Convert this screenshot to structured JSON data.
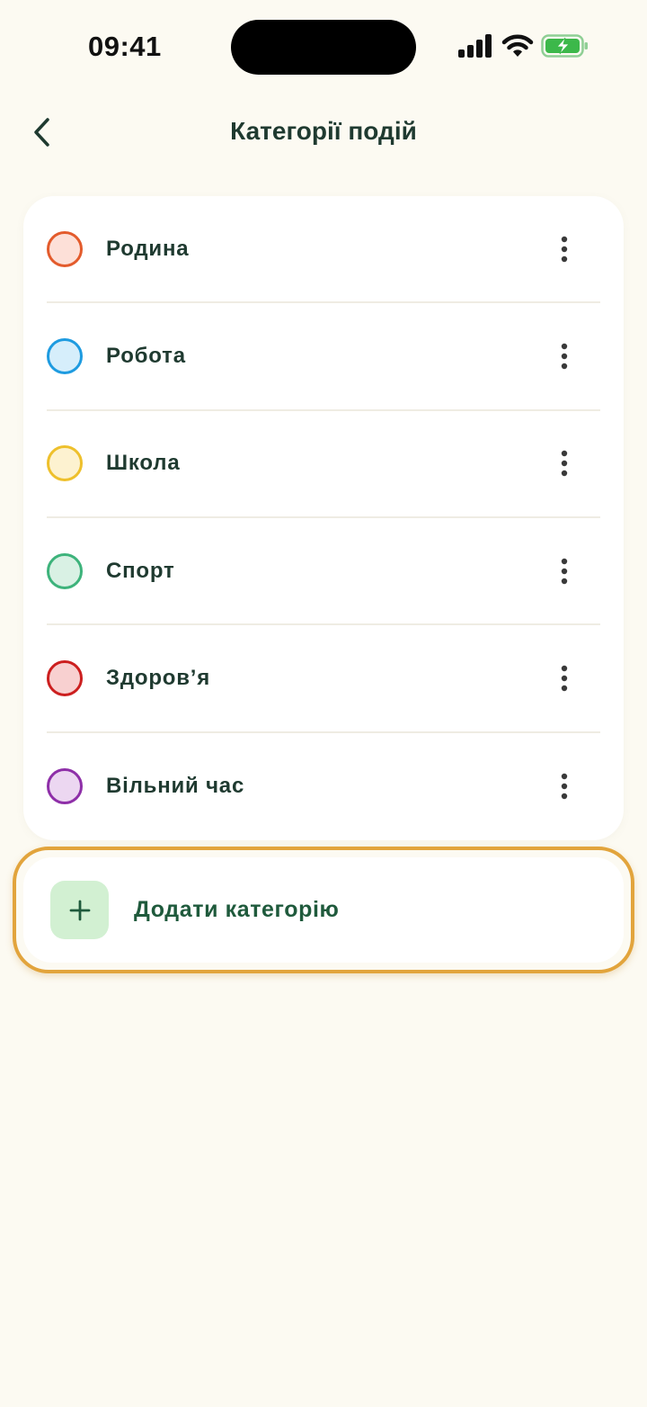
{
  "status_bar": {
    "time": "09:41",
    "icons": [
      "cellular-signal-icon",
      "wifi-icon",
      "battery-charging-icon"
    ],
    "battery_color": "#3cb84a"
  },
  "header": {
    "title": "Категорії подій",
    "back_icon": "chevron-left-icon"
  },
  "categories": [
    {
      "label": "Родина",
      "stroke": "#e35b2c",
      "fill": "#fde0d8"
    },
    {
      "label": "Робота",
      "stroke": "#1e9be0",
      "fill": "#d6eefb"
    },
    {
      "label": "Школа",
      "stroke": "#eec02c",
      "fill": "#fdf2d0"
    },
    {
      "label": "Спорт",
      "stroke": "#3db37b",
      "fill": "#d9f1e4"
    },
    {
      "label": "Здоров’я",
      "stroke": "#cc1f1f",
      "fill": "#f8d0d0"
    },
    {
      "label": "Вільний час",
      "stroke": "#8e2fa8",
      "fill": "#ecd7f1"
    }
  ],
  "row_action_icon": "more-vertical-icon",
  "add_category": {
    "label": "Додати категорію",
    "icon": "plus-icon",
    "highlight_color": "#e2a43c"
  }
}
